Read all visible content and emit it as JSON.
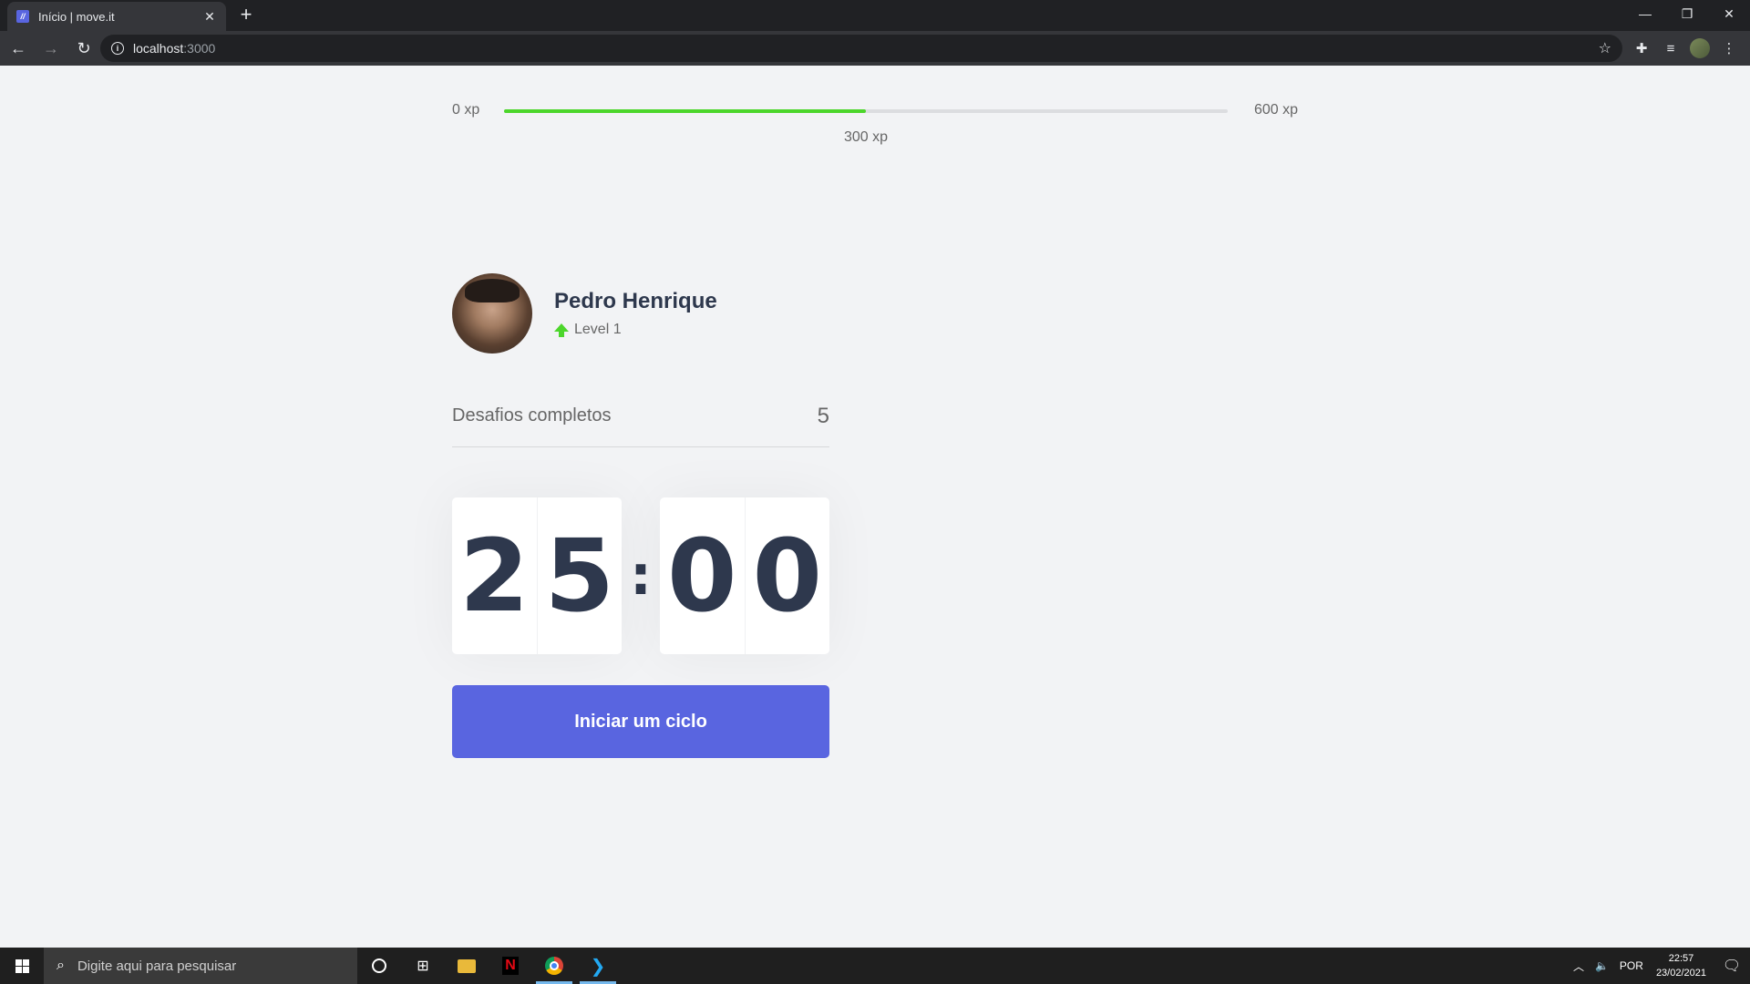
{
  "browser": {
    "tab_title": "Início | move.it",
    "tab_favicon": "move-it-favicon",
    "url_host": "localhost",
    "url_port": ":3000"
  },
  "experience": {
    "min_label": "0 xp",
    "max_label": "600 xp",
    "current_label": "300 xp",
    "progress_fraction": 0.5,
    "fill_color": "#4cd62b"
  },
  "profile": {
    "name": "Pedro Henrique",
    "level_label": "Level 1"
  },
  "challenges": {
    "label": "Desafios completos",
    "count": "5"
  },
  "countdown": {
    "minute_left": "2",
    "minute_right": "5",
    "separator": ":",
    "second_left": "0",
    "second_right": "0"
  },
  "start_button": {
    "label": "Iniciar um ciclo",
    "color": "#5965e0"
  },
  "taskbar": {
    "search_placeholder": "Digite aqui para pesquisar",
    "language": "POR",
    "time": "22:57",
    "date": "23/02/2021"
  }
}
